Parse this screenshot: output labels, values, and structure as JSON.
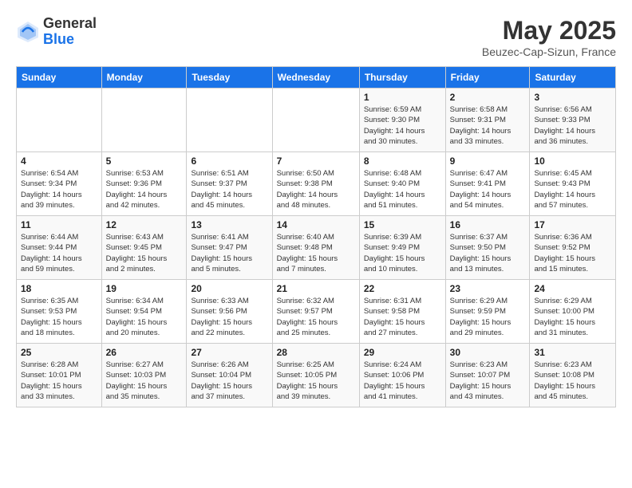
{
  "logo": {
    "general": "General",
    "blue": "Blue"
  },
  "title": {
    "month_year": "May 2025",
    "location": "Beuzec-Cap-Sizun, France"
  },
  "headers": [
    "Sunday",
    "Monday",
    "Tuesday",
    "Wednesday",
    "Thursday",
    "Friday",
    "Saturday"
  ],
  "weeks": [
    [
      {
        "day": "",
        "detail": ""
      },
      {
        "day": "",
        "detail": ""
      },
      {
        "day": "",
        "detail": ""
      },
      {
        "day": "",
        "detail": ""
      },
      {
        "day": "1",
        "detail": "Sunrise: 6:59 AM\nSunset: 9:30 PM\nDaylight: 14 hours\nand 30 minutes."
      },
      {
        "day": "2",
        "detail": "Sunrise: 6:58 AM\nSunset: 9:31 PM\nDaylight: 14 hours\nand 33 minutes."
      },
      {
        "day": "3",
        "detail": "Sunrise: 6:56 AM\nSunset: 9:33 PM\nDaylight: 14 hours\nand 36 minutes."
      }
    ],
    [
      {
        "day": "4",
        "detail": "Sunrise: 6:54 AM\nSunset: 9:34 PM\nDaylight: 14 hours\nand 39 minutes."
      },
      {
        "day": "5",
        "detail": "Sunrise: 6:53 AM\nSunset: 9:36 PM\nDaylight: 14 hours\nand 42 minutes."
      },
      {
        "day": "6",
        "detail": "Sunrise: 6:51 AM\nSunset: 9:37 PM\nDaylight: 14 hours\nand 45 minutes."
      },
      {
        "day": "7",
        "detail": "Sunrise: 6:50 AM\nSunset: 9:38 PM\nDaylight: 14 hours\nand 48 minutes."
      },
      {
        "day": "8",
        "detail": "Sunrise: 6:48 AM\nSunset: 9:40 PM\nDaylight: 14 hours\nand 51 minutes."
      },
      {
        "day": "9",
        "detail": "Sunrise: 6:47 AM\nSunset: 9:41 PM\nDaylight: 14 hours\nand 54 minutes."
      },
      {
        "day": "10",
        "detail": "Sunrise: 6:45 AM\nSunset: 9:43 PM\nDaylight: 14 hours\nand 57 minutes."
      }
    ],
    [
      {
        "day": "11",
        "detail": "Sunrise: 6:44 AM\nSunset: 9:44 PM\nDaylight: 14 hours\nand 59 minutes."
      },
      {
        "day": "12",
        "detail": "Sunrise: 6:43 AM\nSunset: 9:45 PM\nDaylight: 15 hours\nand 2 minutes."
      },
      {
        "day": "13",
        "detail": "Sunrise: 6:41 AM\nSunset: 9:47 PM\nDaylight: 15 hours\nand 5 minutes."
      },
      {
        "day": "14",
        "detail": "Sunrise: 6:40 AM\nSunset: 9:48 PM\nDaylight: 15 hours\nand 7 minutes."
      },
      {
        "day": "15",
        "detail": "Sunrise: 6:39 AM\nSunset: 9:49 PM\nDaylight: 15 hours\nand 10 minutes."
      },
      {
        "day": "16",
        "detail": "Sunrise: 6:37 AM\nSunset: 9:50 PM\nDaylight: 15 hours\nand 13 minutes."
      },
      {
        "day": "17",
        "detail": "Sunrise: 6:36 AM\nSunset: 9:52 PM\nDaylight: 15 hours\nand 15 minutes."
      }
    ],
    [
      {
        "day": "18",
        "detail": "Sunrise: 6:35 AM\nSunset: 9:53 PM\nDaylight: 15 hours\nand 18 minutes."
      },
      {
        "day": "19",
        "detail": "Sunrise: 6:34 AM\nSunset: 9:54 PM\nDaylight: 15 hours\nand 20 minutes."
      },
      {
        "day": "20",
        "detail": "Sunrise: 6:33 AM\nSunset: 9:56 PM\nDaylight: 15 hours\nand 22 minutes."
      },
      {
        "day": "21",
        "detail": "Sunrise: 6:32 AM\nSunset: 9:57 PM\nDaylight: 15 hours\nand 25 minutes."
      },
      {
        "day": "22",
        "detail": "Sunrise: 6:31 AM\nSunset: 9:58 PM\nDaylight: 15 hours\nand 27 minutes."
      },
      {
        "day": "23",
        "detail": "Sunrise: 6:29 AM\nSunset: 9:59 PM\nDaylight: 15 hours\nand 29 minutes."
      },
      {
        "day": "24",
        "detail": "Sunrise: 6:29 AM\nSunset: 10:00 PM\nDaylight: 15 hours\nand 31 minutes."
      }
    ],
    [
      {
        "day": "25",
        "detail": "Sunrise: 6:28 AM\nSunset: 10:01 PM\nDaylight: 15 hours\nand 33 minutes."
      },
      {
        "day": "26",
        "detail": "Sunrise: 6:27 AM\nSunset: 10:03 PM\nDaylight: 15 hours\nand 35 minutes."
      },
      {
        "day": "27",
        "detail": "Sunrise: 6:26 AM\nSunset: 10:04 PM\nDaylight: 15 hours\nand 37 minutes."
      },
      {
        "day": "28",
        "detail": "Sunrise: 6:25 AM\nSunset: 10:05 PM\nDaylight: 15 hours\nand 39 minutes."
      },
      {
        "day": "29",
        "detail": "Sunrise: 6:24 AM\nSunset: 10:06 PM\nDaylight: 15 hours\nand 41 minutes."
      },
      {
        "day": "30",
        "detail": "Sunrise: 6:23 AM\nSunset: 10:07 PM\nDaylight: 15 hours\nand 43 minutes."
      },
      {
        "day": "31",
        "detail": "Sunrise: 6:23 AM\nSunset: 10:08 PM\nDaylight: 15 hours\nand 45 minutes."
      }
    ]
  ]
}
